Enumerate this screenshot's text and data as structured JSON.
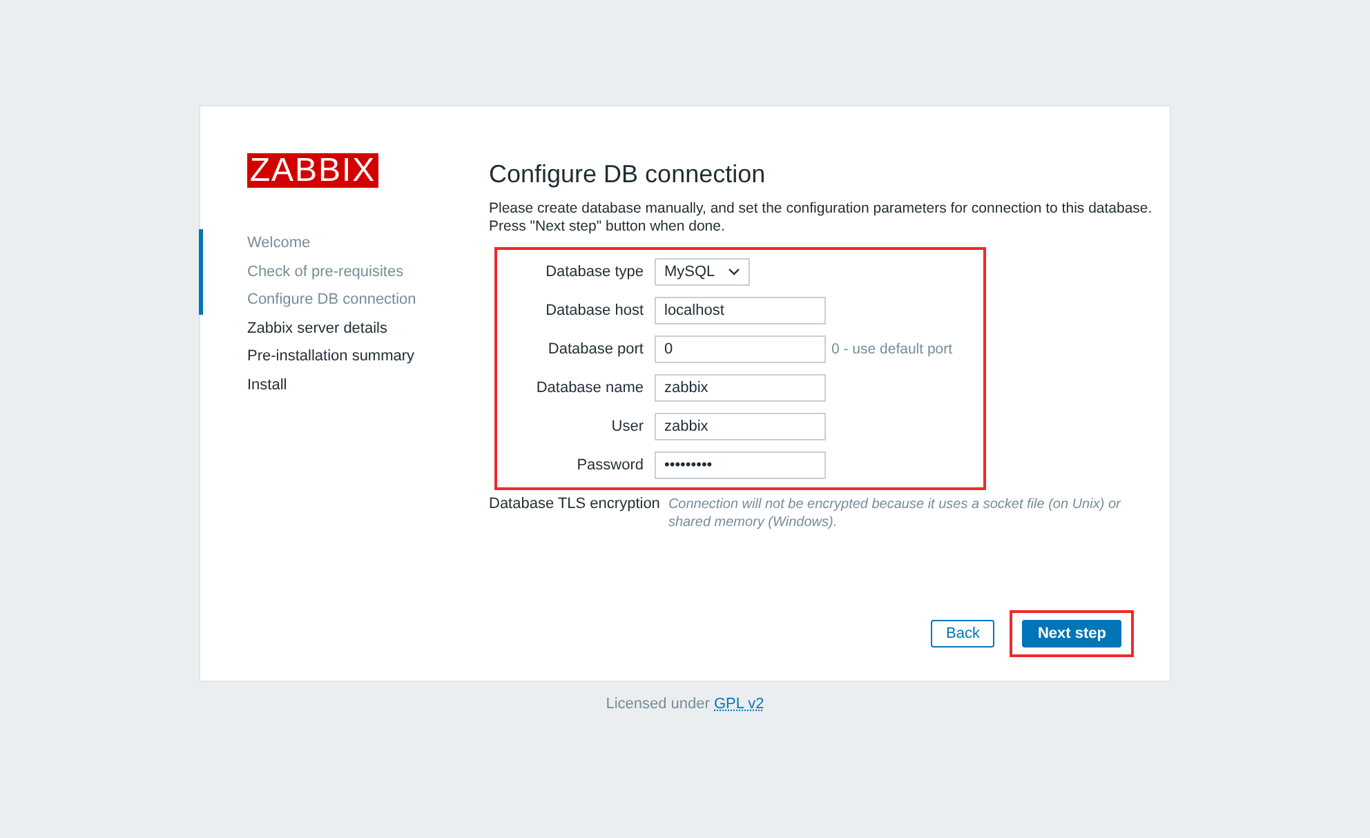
{
  "logo": "ZABBIX",
  "steps": [
    {
      "label": "Welcome",
      "done": true
    },
    {
      "label": "Check of pre-requisites",
      "done": true
    },
    {
      "label": "Configure DB connection",
      "done": true
    },
    {
      "label": "Zabbix server details",
      "done": false
    },
    {
      "label": "Pre-installation summary",
      "done": false
    },
    {
      "label": "Install",
      "done": false
    }
  ],
  "title": "Configure DB connection",
  "description": [
    "Please create database manually, and set the configuration parameters for connection to this database.",
    "Press \"Next step\" button when done."
  ],
  "form": {
    "highlighted": true,
    "fields": [
      {
        "kind": "select",
        "label": "Database type",
        "value": "MySQL"
      },
      {
        "kind": "text",
        "label": "Database host",
        "value": "localhost"
      },
      {
        "kind": "text",
        "label": "Database port",
        "value": "0",
        "hint": "0 - use default port"
      },
      {
        "kind": "text",
        "label": "Database name",
        "value": "zabbix"
      },
      {
        "kind": "text",
        "label": "User",
        "value": "zabbix"
      },
      {
        "kind": "password",
        "label": "Password",
        "value": "•••••••••"
      }
    ]
  },
  "tls": {
    "label": "Database TLS encryption",
    "note": "Connection will not be encrypted because it uses a socket file (on Unix) or shared memory (Windows)."
  },
  "buttons": [
    {
      "label": "Back",
      "kind": "secondary",
      "highlighted": false
    },
    {
      "label": "Next step",
      "kind": "primary",
      "highlighted": true
    }
  ],
  "footer": {
    "text": "Licensed under",
    "link": "GPL v2"
  }
}
